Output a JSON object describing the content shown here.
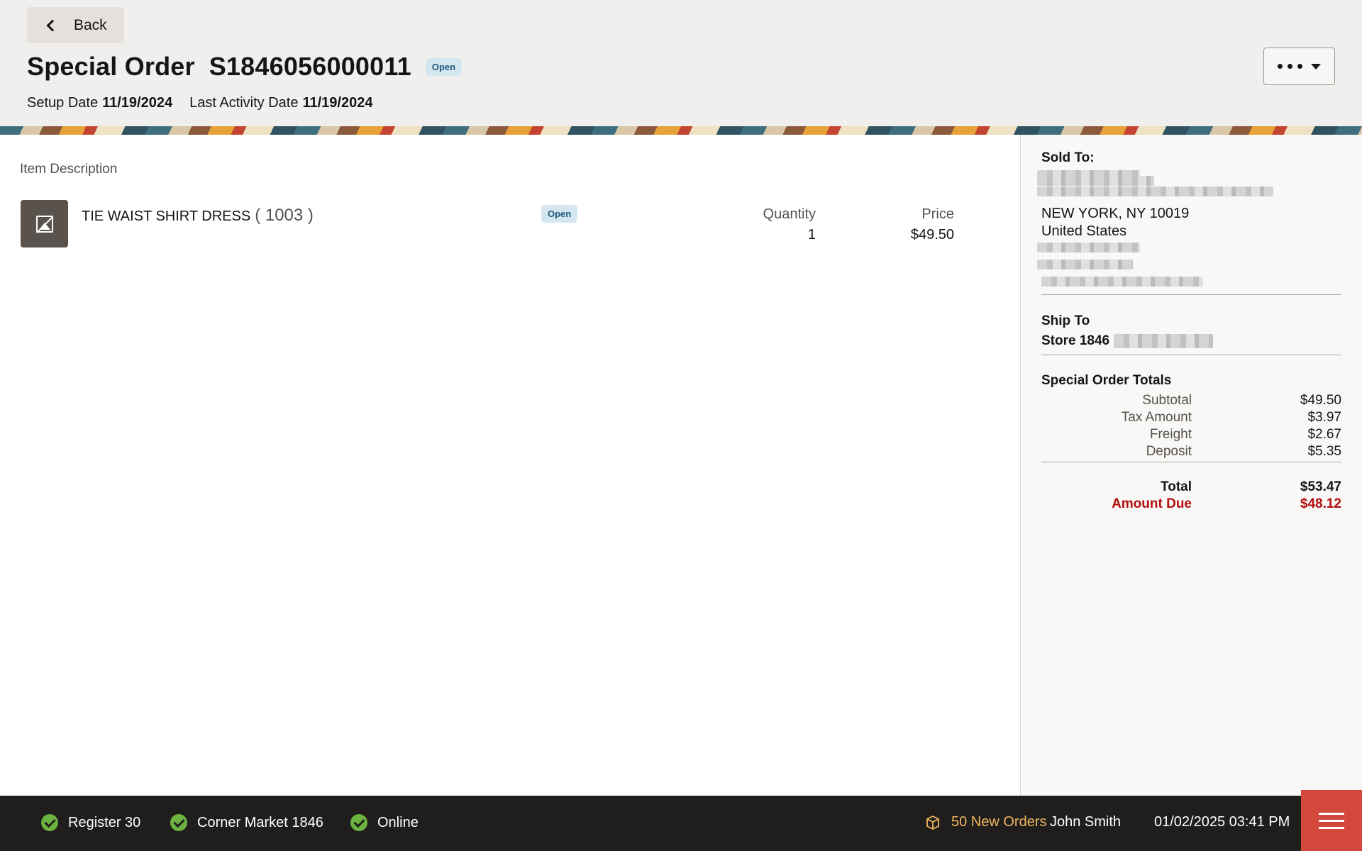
{
  "header": {
    "back_label": "Back",
    "title_prefix": "Special Order",
    "order_number": "S1846056000011",
    "status": "Open",
    "setup_date_label": "Setup Date",
    "setup_date": "11/19/2024",
    "last_activity_label": "Last Activity Date",
    "last_activity_date": "11/19/2024"
  },
  "items": {
    "column_header": "Item Description",
    "quantity_label": "Quantity",
    "price_label": "Price",
    "rows": [
      {
        "name": "TIE WAIST SHIRT DRESS",
        "code": "( 1003 )",
        "status": "Open",
        "quantity": "1",
        "price": "$49.50",
        "thumbnail_icon": "no-image-icon"
      }
    ]
  },
  "sidebar": {
    "sold_to_label": "Sold To:",
    "city_line": "NEW YORK, NY 10019",
    "country": "United States",
    "ship_to_label": "Ship To",
    "ship_to_store": "Store 1846",
    "totals_label": "Special Order Totals",
    "subtotal_label": "Subtotal",
    "subtotal": "$49.50",
    "tax_label": "Tax Amount",
    "tax": "$3.97",
    "freight_label": "Freight",
    "freight": "$2.67",
    "deposit_label": "Deposit",
    "deposit": "$5.35",
    "total_label": "Total",
    "total": "$53.47",
    "amount_due_label": "Amount Due",
    "amount_due": "$48.12"
  },
  "footer": {
    "register": "Register 30",
    "store": "Corner Market 1846",
    "connection": "Online",
    "new_orders": "50 New Orders",
    "user": "John Smith",
    "datetime": "01/02/2025 03:41 PM"
  },
  "colors": {
    "accent_red": "#d2483a",
    "amount_due": "#b20e0e",
    "status_ok": "#6cb33f",
    "orders_highlight": "#f0b860",
    "badge_bg": "#d4e7f1"
  }
}
